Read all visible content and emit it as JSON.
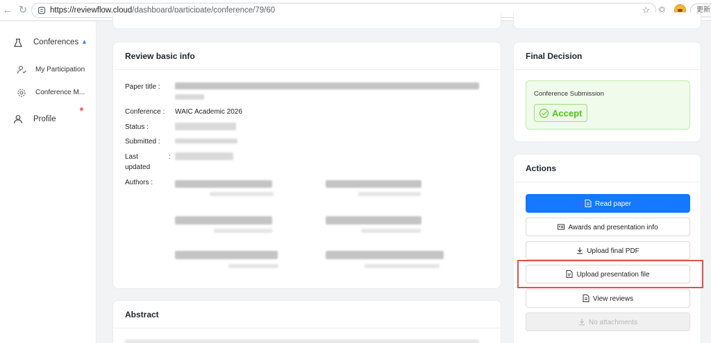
{
  "browser": {
    "url_host": "https://reviewflow.cloud",
    "url_path": "/dashboard/participate/conference/79/60",
    "update_label": "更新 "
  },
  "sidebar": {
    "items": [
      {
        "label": "Conferences",
        "icon": "flask-icon"
      },
      {
        "label": "My Participation",
        "icon": "participation-icon"
      },
      {
        "label": "Conference M...",
        "icon": "gear-icon"
      },
      {
        "label": "Profile",
        "icon": "user-icon"
      }
    ]
  },
  "review_info": {
    "title": "Review basic info",
    "labels": {
      "paper_title": "Paper title",
      "conference": "Conference",
      "status": "Status",
      "submitted": "Submitted",
      "last_updated_1": "Last",
      "last_updated_2": "updated",
      "authors": "Authors"
    },
    "colon": ":",
    "conference_value": "WAIC Academic 2026"
  },
  "abstract": {
    "title": "Abstract"
  },
  "final_decision": {
    "title": "Final Decision",
    "label": "Conference Submission",
    "decision": "Accept"
  },
  "actions": {
    "title": "Actions",
    "read_paper": "Read paper",
    "awards": "Awards and presentation info",
    "upload_pdf": "Upload final PDF",
    "upload_presentation": "Upload presentation file",
    "view_reviews": "View reviews",
    "no_attachments": "No attachments"
  },
  "colors": {
    "primary": "#1677ff",
    "accept": "#52c41a",
    "highlight": "#e0504a"
  }
}
